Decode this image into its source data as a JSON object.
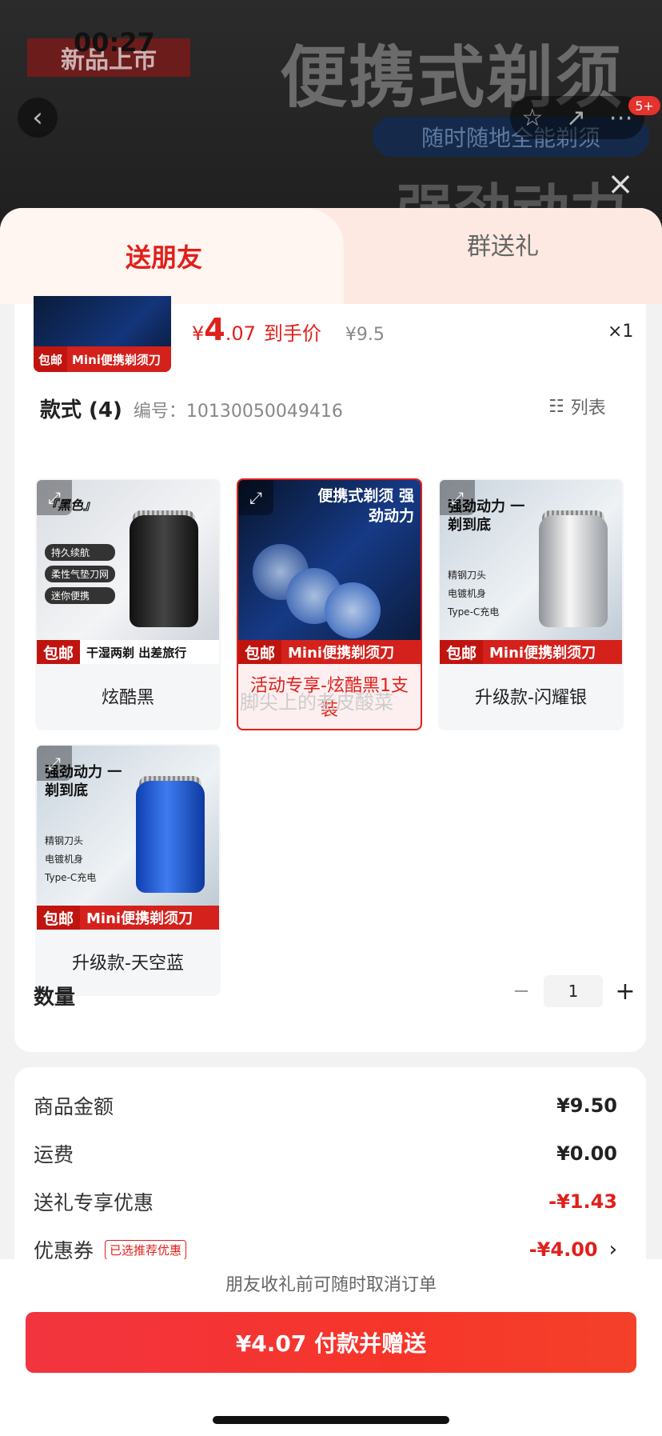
{
  "status_bar": {
    "time": "00:27",
    "right": "…"
  },
  "banner": {
    "new_tag": "新品上市",
    "title": "便携式剃须",
    "pill": "随时随地全能剃须",
    "subtitle": "强劲动力",
    "badge": "5+"
  },
  "tabs": [
    {
      "label": "送朋友",
      "active": true
    },
    {
      "label": "群送礼",
      "active": false
    }
  ],
  "product": {
    "thumb_tag_mail": "包邮",
    "thumb_tag_text": "Mini便携剃须刀",
    "price_currency": "¥",
    "price_int": "4",
    "price_dec": ".07",
    "price_label": "到手价",
    "original_price": "¥9.5",
    "quantity_mark": "×1"
  },
  "styles": {
    "title": "款式 (4)",
    "code": "编号：10130050049416",
    "list_label": "列表",
    "variants": [
      {
        "name": "炫酷黑",
        "mail": "包邮",
        "strip": "干湿两剃  出差旅行",
        "promo": "『黑色』",
        "tags": [
          "持久续航",
          "柔性气垫刀网",
          "迷你便携"
        ],
        "selected": false
      },
      {
        "name": "活动专享-炫酷黑1支装",
        "mail": "包邮",
        "strip": "Mini便携剃须刀",
        "promo": "便携式剃须 强劲动力",
        "tags": [],
        "selected": true
      },
      {
        "name": "升级款-闪耀银",
        "mail": "包邮",
        "strip": "Mini便携剃须刀",
        "promo": "强劲动力 一剃到底",
        "tags": [
          "精钢刀头",
          "电镀机身",
          "Type-C充电"
        ],
        "selected": false
      },
      {
        "name": "升级款-天空蓝",
        "mail": "包邮",
        "strip": "Mini便携剃须刀",
        "promo": "强劲动力 一剃到底",
        "tags": [
          "精钢刀头",
          "电镀机身",
          "Type-C充电"
        ],
        "selected": false
      }
    ]
  },
  "watermark": "脚尖上的老皮酸菜",
  "quantity": {
    "label": "数量",
    "value": "1",
    "minus": "−",
    "plus": "+"
  },
  "summary": {
    "goods_label": "商品金额",
    "goods_value": "¥9.50",
    "shipping_label": "运费",
    "shipping_value": "¥0.00",
    "gift_label": "送礼专享优惠",
    "gift_value": "-¥1.43",
    "coupon_label": "优惠券",
    "coupon_tag": "已选推荐优惠",
    "coupon_value": "-¥4.00"
  },
  "footer": {
    "cancel_note": "朋友收礼前可随时取消订单",
    "pay_button": "¥4.07 付款并赠送"
  },
  "colors": {
    "accent": "#e0201b",
    "tab_bg": "#fde9e1",
    "strip": "#d4211c"
  }
}
